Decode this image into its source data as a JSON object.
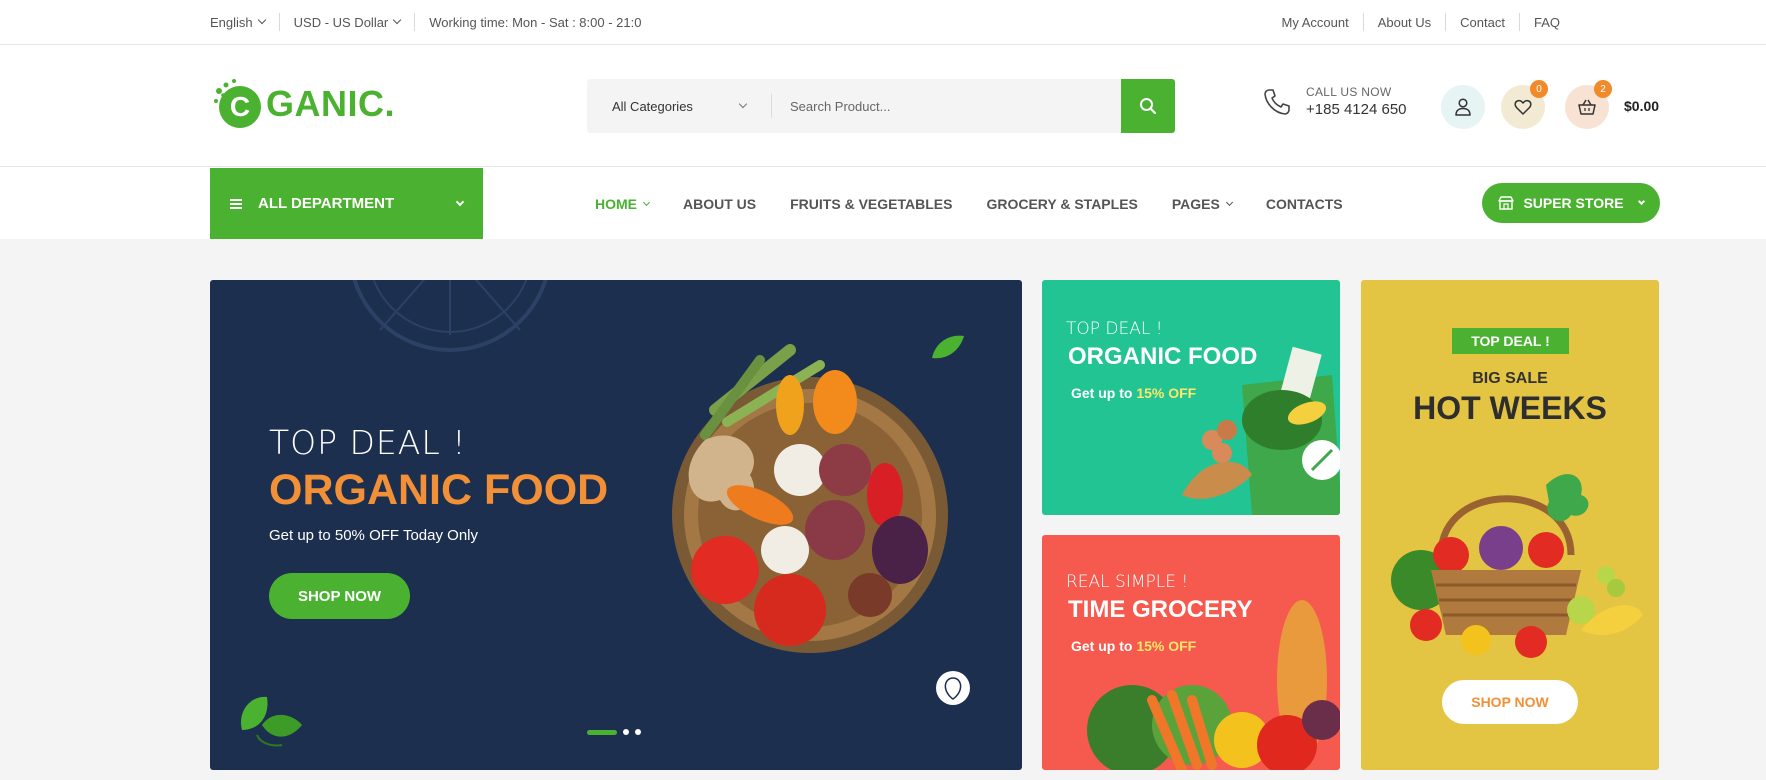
{
  "topbar": {
    "language": "English",
    "currency": "USD - US Dollar",
    "working_time": "Working time: Mon - Sat : 8:00 - 21:0",
    "links": [
      "My Account",
      "About Us",
      "Contact",
      "FAQ"
    ]
  },
  "header": {
    "logo_text": "GANIC.",
    "logo_letter": "C",
    "category_select": "All Categories",
    "search_placeholder": "Search Product...",
    "call_label": "CALL US NOW",
    "call_number": "+185 4124 650",
    "wishlist_count": "0",
    "cart_count": "2",
    "cart_total": "$0.00"
  },
  "nav": {
    "department": "ALL DEPARTMENT",
    "menu": [
      "HOME",
      "ABOUT US",
      "FRUITS & VEGETABLES",
      "GROCERY & STAPLES",
      "PAGES",
      "CONTACTS"
    ],
    "super_store": "SUPER STORE"
  },
  "hero": {
    "kicker": "TOP DEAL !",
    "title": "ORGANIC FOOD",
    "subtitle": "Get up to 50% OFF Today Only",
    "cta": "SHOP NOW"
  },
  "banner_green": {
    "kicker": "TOP DEAL !",
    "title": "ORGANIC FOOD",
    "offer_prefix": "Get up to ",
    "offer_value": "15% OFF"
  },
  "banner_red": {
    "kicker": "REAL SIMPLE !",
    "title": "TIME GROCERY",
    "offer_prefix": "Get up to ",
    "offer_value": "15% OFF"
  },
  "banner_tall": {
    "badge": "TOP DEAL !",
    "kicker": "BIG SALE",
    "title": "HOT WEEKS",
    "cta": "SHOP NOW"
  },
  "colors": {
    "brand_green": "#4bb231",
    "accent_orange": "#f29037",
    "hero_bg": "#1d2f4f",
    "green_banner": "#23c494",
    "red_banner": "#f65a4e",
    "yellow_banner": "#e4c443"
  }
}
